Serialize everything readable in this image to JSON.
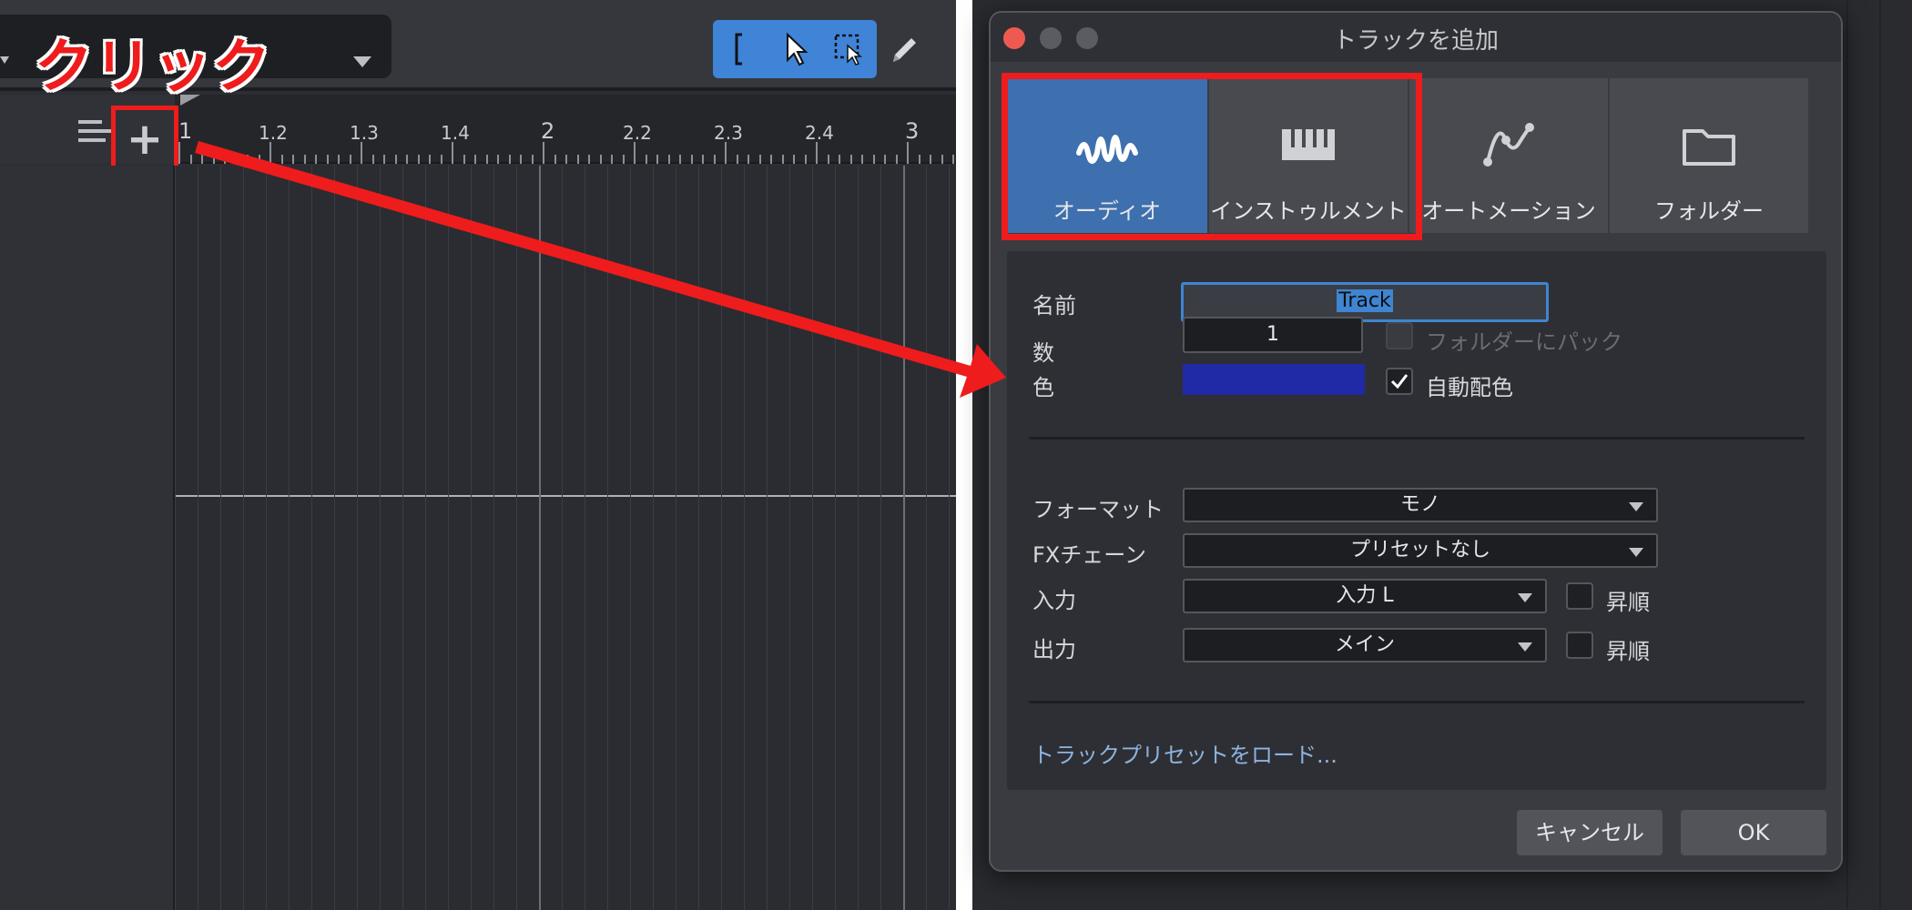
{
  "annotation": {
    "click_label": "クリック"
  },
  "ruler": {
    "labels": [
      "1",
      "1.2",
      "1.3",
      "1.4",
      "2",
      "2.2",
      "2.3",
      "2.4",
      "3"
    ]
  },
  "tools": [
    "range-icon",
    "pointer-icon",
    "marquee-select-icon",
    "pencil-icon"
  ],
  "dialog": {
    "title": "トラックを追加",
    "tabs": [
      {
        "label": "オーディオ",
        "icon": "waveform-icon",
        "active": true
      },
      {
        "label": "インストゥルメント",
        "icon": "piano-keys-icon",
        "active": false
      },
      {
        "label": "オートメーション",
        "icon": "automation-curve-icon",
        "active": false
      },
      {
        "label": "フォルダー",
        "icon": "folder-icon",
        "active": false
      }
    ],
    "fields": {
      "name_label": "名前",
      "name_value": "Track",
      "count_label": "数",
      "count_value": "1",
      "pack_folder_label": "フォルダーにパック",
      "pack_folder_checked": false,
      "color_label": "色",
      "color_value": "#2029a6",
      "auto_color_label": "自動配色",
      "auto_color_checked": true
    },
    "routing": {
      "format_label": "フォーマット",
      "format_value": "モノ",
      "fx_label": "FXチェーン",
      "fx_value": "プリセットなし",
      "input_label": "入力",
      "input_value": "入力 L",
      "input_ascend_label": "昇順",
      "output_label": "出力",
      "output_value": "メイン",
      "output_ascend_label": "昇順"
    },
    "preset_link": "トラックプリセットをロード...",
    "buttons": {
      "cancel": "キャンセル",
      "ok": "OK"
    }
  },
  "colors": {
    "highlight": "#ee1c1c",
    "accent_blue": "#3e6fae",
    "track_color": "#2029a6"
  }
}
